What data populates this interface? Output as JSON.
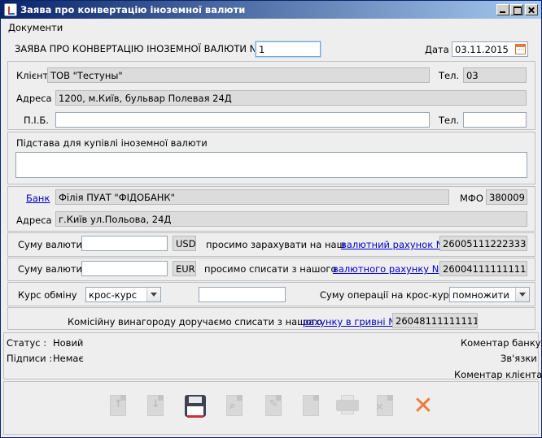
{
  "window": {
    "title": "Заява про конвертацію іноземної валюти"
  },
  "menu": {
    "documents": "Документи"
  },
  "header": {
    "label": "ЗАЯВА ПРО КОНВЕРТАЦІЮ ІНОЗЕМНОЇ ВАЛЮТИ N",
    "number": "1",
    "date_label": "Дата",
    "date_value": "03.11.2015"
  },
  "client": {
    "client_label": "Клієнт",
    "client_value": "ТОВ \"Тестуны\"",
    "phone_label": "Тел.",
    "phone_value": "03",
    "address_label": "Адреса",
    "address_value": "1200, м.Київ, бульвар Полевая 24Д",
    "name_label": "П.І.Б.",
    "name_value": "",
    "phone2_label": "Тел.",
    "phone2_value": ""
  },
  "basis": {
    "label": "Підстава для купівлі іноземної валюти",
    "value": ""
  },
  "bank": {
    "bank_label": "Банк",
    "bank_value": "Філія ПУАТ \"ФІДОБАНК\"",
    "mfo_label": "МФО",
    "mfo_value": "380009",
    "address_label": "Адреса",
    "address_value": "г.Київ ул.Польова, 24Д"
  },
  "credit": {
    "sum_label": "Суму валюти",
    "sum_value": "",
    "currency": "USD",
    "text": "просимо зарахувати на наш",
    "account_link": "валютний рахунок N",
    "account_value": "26005111222333"
  },
  "debit": {
    "sum_label": "Суму валюти",
    "sum_value": "",
    "currency": "EUR",
    "text": "просимо списати з нашого",
    "account_link": "валютного рахунку N",
    "account_value": "26004111111111"
  },
  "rate": {
    "label": "Курс обміну",
    "type_value": "крос-курс",
    "rate_value": "",
    "op_label": "Суму операції на крос-курс",
    "op_value": "помножити"
  },
  "commission": {
    "text": "Комісійну винагороду доручаємо списати з нашого",
    "link": "рахунку в гривні N",
    "account_value": "26048111111111"
  },
  "status": {
    "status_label": "Статус :",
    "status_value": "Новий",
    "signatures_label": "Підписи :",
    "signatures_value": "Немає",
    "bank_comment": "Коментар банку",
    "links": "Зв'язки",
    "client_comment": "Коментар клієнта"
  },
  "toolbar": {
    "icons": [
      "document-up-icon",
      "document-down-icon",
      "save-icon",
      "document-search-icon",
      "document-edit-icon",
      "document-icon",
      "printer-icon",
      "document-delete-icon",
      "close-icon"
    ]
  }
}
